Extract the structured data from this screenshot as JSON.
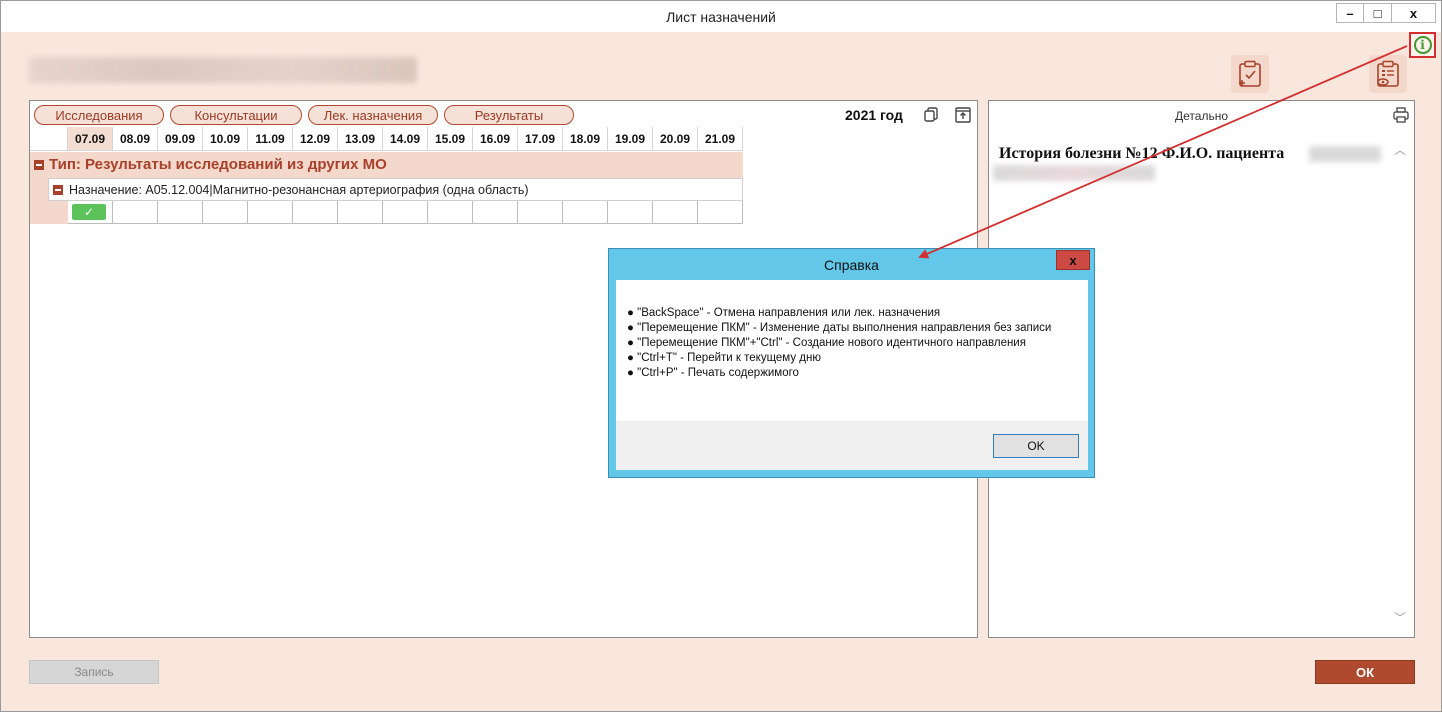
{
  "window": {
    "title": "Лист назначений",
    "min_glyph": "–",
    "max_glyph": "□",
    "close_glyph": "x"
  },
  "info": {
    "glyph": "i"
  },
  "tabs": [
    "Исследования",
    "Консультации",
    "Лек. назначения",
    "Результаты"
  ],
  "year_label": "2021 год",
  "dates": [
    "07.09",
    "08.09",
    "09.09",
    "10.09",
    "11.09",
    "12.09",
    "13.09",
    "14.09",
    "15.09",
    "16.09",
    "17.09",
    "18.09",
    "19.09",
    "20.09",
    "21.09"
  ],
  "group": {
    "label": "Тип: Результаты исследований из других МО"
  },
  "assignment": {
    "label": "Назначение: A05.12.004|Магнитно-резонансная артериография (одна область)",
    "done_glyph": "✓",
    "done_date_index": 0
  },
  "details": {
    "caption": "Детально",
    "history_title": "История болезни №12 Ф.И.О. пациента"
  },
  "buttons": {
    "record": "Запись",
    "ok": "ОК"
  },
  "dialog": {
    "title": "Справка",
    "close_glyph": "x",
    "items": [
      "● \"BackSpace\" - Отмена направления или лек. назначения",
      "● \"Перемещение ПКМ\" - Изменение даты выполнения направления без записи",
      "● \"Перемещение ПКМ\"+\"Ctrl\" - Создание нового идентичного направления",
      "● \"Ctrl+T\" - Перейти к текущему дню",
      "● \"Ctrl+P\" - Печать содержимого"
    ],
    "ok": "OK"
  },
  "colors": {
    "accent": "#a8412b",
    "background": "#f9e7de",
    "dialog_frame": "#62c7e8",
    "annotation_arrow": "#d23030",
    "done": "#5cc35a"
  }
}
